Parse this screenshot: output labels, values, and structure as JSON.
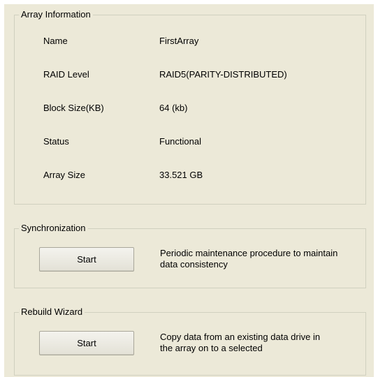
{
  "array_info": {
    "title": "Array Information",
    "rows": [
      {
        "label": "Name",
        "value": "FirstArray"
      },
      {
        "label": "RAID Level",
        "value": "RAID5(PARITY-DISTRIBUTED)"
      },
      {
        "label": "Block Size(KB)",
        "value": "64 (kb)"
      },
      {
        "label": "Status",
        "value": "Functional"
      },
      {
        "label": "Array Size",
        "value": "33.521 GB"
      }
    ]
  },
  "synchronization": {
    "title": "Synchronization",
    "button_label": "Start",
    "description": "Periodic maintenance procedure to maintain data consistency"
  },
  "rebuild_wizard": {
    "title": "Rebuild Wizard",
    "button_label": "Start",
    "description": "Copy data from an existing data drive in the array on to a selected"
  }
}
